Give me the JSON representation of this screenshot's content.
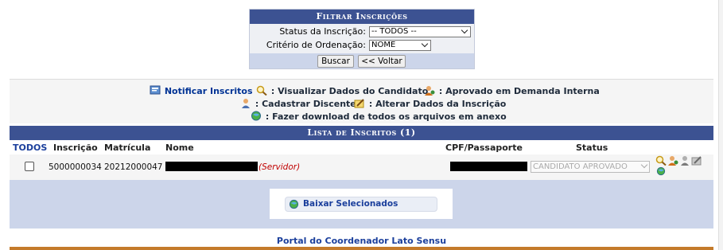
{
  "filter": {
    "title": "Filtrar Inscrições",
    "status_label": "Status da Inscrição:",
    "status_value": "-- TODOS --",
    "order_label": "Critério de Ordenação:",
    "order_value": "NOME",
    "search_button": "Buscar",
    "back_button": "<< Voltar"
  },
  "legend": {
    "notify": "Notificar Inscritos",
    "view": ": Visualizar Dados do Candidato",
    "approved": ": Aprovado em Demanda Interna",
    "register": ": Cadastrar Discente",
    "edit": ": Alterar Dados da Inscrição",
    "download": ": Fazer download de todos os arquivos em anexo"
  },
  "list": {
    "title": "Lista de Inscritos (1)",
    "headers": {
      "all": "TODOS",
      "inscricao": "Inscrição",
      "matricula": "Matrícula",
      "nome": "Nome",
      "cpf": "CPF/Passaporte",
      "status": "Status"
    },
    "rows": [
      {
        "inscricao": "5000000034",
        "matricula": "20212000047",
        "servidor": "(Servidor)",
        "status": "CANDIDATO APROVADO"
      }
    ],
    "download_selected": "Baixar Selecionados"
  },
  "footer": {
    "portal": "Portal do Coordenador Lato Sensu"
  },
  "colors": {
    "header_blue": "#3c5292",
    "link_blue": "#1b3f9c",
    "light_blue": "#ccd5ea",
    "servidor_red": "#c00000"
  }
}
